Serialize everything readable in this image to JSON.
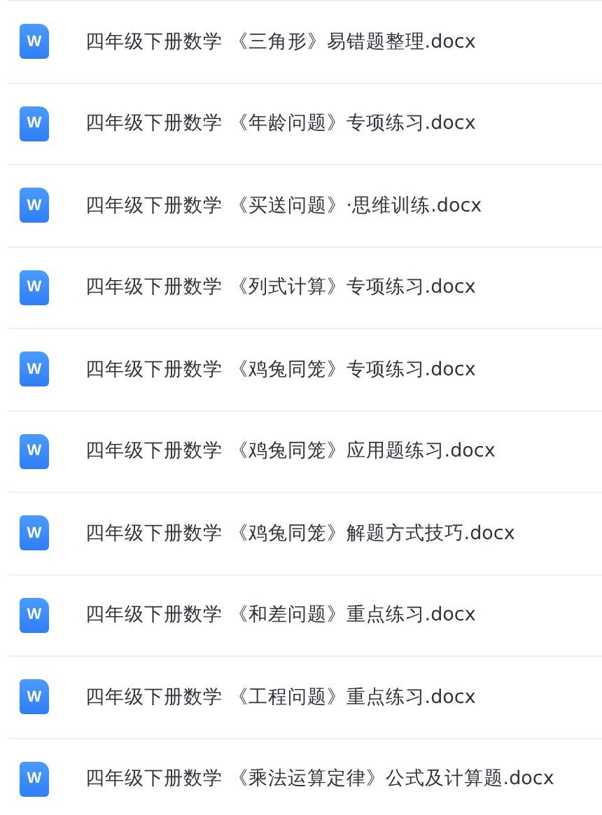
{
  "files": [
    {
      "icon_letter": "W",
      "name": "四年级下册数学 《三角形》易错题整理.docx"
    },
    {
      "icon_letter": "W",
      "name": "四年级下册数学 《年龄问题》专项练习.docx"
    },
    {
      "icon_letter": "W",
      "name": "四年级下册数学 《买送问题》·思维训练.docx"
    },
    {
      "icon_letter": "W",
      "name": "四年级下册数学 《列式计算》专项练习.docx"
    },
    {
      "icon_letter": "W",
      "name": "四年级下册数学 《鸡兔同笼》专项练习.docx"
    },
    {
      "icon_letter": "W",
      "name": "四年级下册数学 《鸡兔同笼》应用题练习.docx"
    },
    {
      "icon_letter": "W",
      "name": "四年级下册数学 《鸡兔同笼》解题方式技巧.docx"
    },
    {
      "icon_letter": "W",
      "name": "四年级下册数学 《和差问题》重点练习.docx"
    },
    {
      "icon_letter": "W",
      "name": "四年级下册数学 《工程问题》重点练习.docx"
    },
    {
      "icon_letter": "W",
      "name": "四年级下册数学 《乘法运算定律》公式及计算题.docx"
    }
  ]
}
